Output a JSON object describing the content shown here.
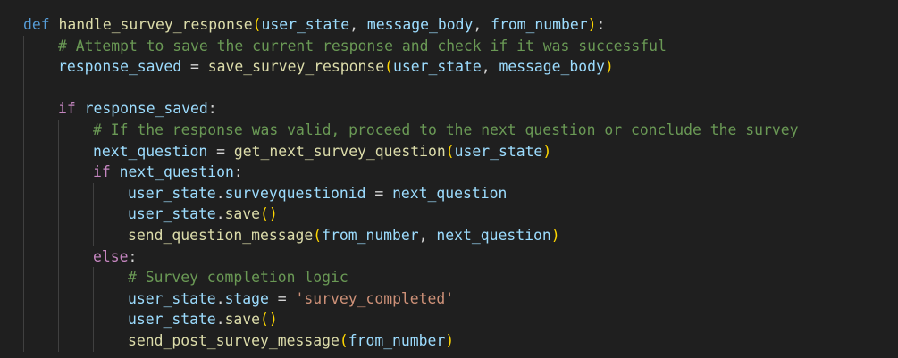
{
  "editor": {
    "language": "python",
    "theme": "dark",
    "colors": {
      "background": "#1f1f1f",
      "keyword_def": "#569cd6",
      "keyword_control": "#c586c0",
      "function": "#dcdcaa",
      "variable": "#9cdcfe",
      "comment": "#6a9955",
      "string": "#ce9178",
      "bracket": "#ffd700"
    }
  },
  "code": {
    "def_kw": "def",
    "def_name": "handle_survey_response",
    "def_open": "(",
    "param1": "user_state",
    "comma1": ", ",
    "param2": "message_body",
    "comma2": ", ",
    "param3": "from_number",
    "def_close": ")",
    "def_colon": ":",
    "comment1": "# Attempt to save the current response and check if it was successful",
    "l3_var": "response_saved",
    "l3_eq": " = ",
    "l3_fn": "save_survey_response",
    "l3_open": "(",
    "l3_a1": "user_state",
    "l3_comma": ", ",
    "l3_a2": "message_body",
    "l3_close": ")",
    "if_kw": "if",
    "if_cond": "response_saved",
    "if_colon": ":",
    "comment2": "# If the response was valid, proceed to the next question or conclude the survey",
    "l7_var": "next_question",
    "l7_eq": " = ",
    "l7_fn": "get_next_survey_question",
    "l7_open": "(",
    "l7_a1": "user_state",
    "l7_close": ")",
    "if2_kw": "if",
    "if2_cond": "next_question",
    "if2_colon": ":",
    "l9_obj": "user_state",
    "l9_dot": ".",
    "l9_attr": "surveyquestionid",
    "l9_eq": " = ",
    "l9_val": "next_question",
    "l10_obj": "user_state",
    "l10_dot": ".",
    "l10_fn": "save",
    "l10_parens": "()",
    "l11_fn": "send_question_message",
    "l11_open": "(",
    "l11_a1": "from_number",
    "l11_comma": ", ",
    "l11_a2": "next_question",
    "l11_close": ")",
    "else_kw": "else",
    "else_colon": ":",
    "comment3": "# Survey completion logic",
    "l14_obj": "user_state",
    "l14_dot": ".",
    "l14_attr": "stage",
    "l14_eq": " = ",
    "l14_str": "'survey_completed'",
    "l15_obj": "user_state",
    "l15_dot": ".",
    "l15_fn": "save",
    "l15_parens": "()",
    "l16_fn": "send_post_survey_message",
    "l16_open": "(",
    "l16_a1": "from_number",
    "l16_close": ")"
  }
}
